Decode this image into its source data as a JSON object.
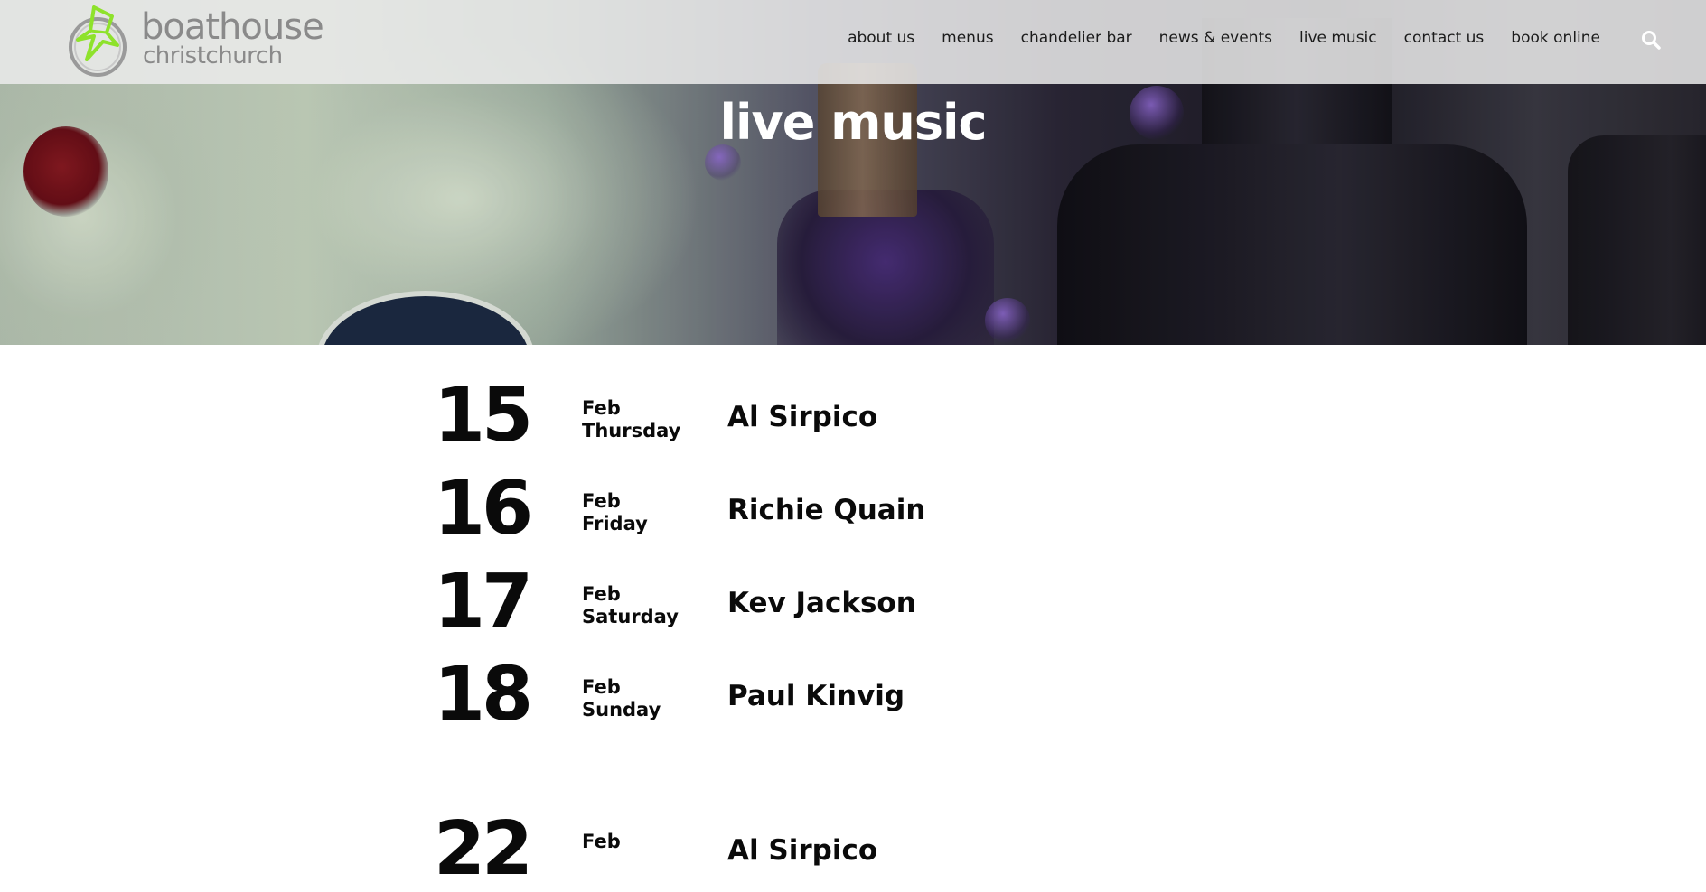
{
  "brand": {
    "name": "boathouse",
    "location": "christchurch"
  },
  "nav": {
    "items": [
      {
        "label": "about us"
      },
      {
        "label": "menus"
      },
      {
        "label": "chandelier bar"
      },
      {
        "label": "news & events"
      },
      {
        "label": "live music"
      },
      {
        "label": "contact us"
      },
      {
        "label": "book online"
      }
    ],
    "search_icon": "search-icon"
  },
  "hero": {
    "title": "live music"
  },
  "events": [
    {
      "day": "15",
      "month": "Feb",
      "weekday": "Thursday",
      "artist": "Al Sirpico"
    },
    {
      "day": "16",
      "month": "Feb",
      "weekday": "Friday",
      "artist": "Richie Quain"
    },
    {
      "day": "17",
      "month": "Feb",
      "weekday": "Saturday",
      "artist": "Kev Jackson"
    },
    {
      "day": "18",
      "month": "Feb",
      "weekday": "Sunday",
      "artist": "Paul Kinvig"
    },
    {
      "day": "22",
      "month": "Feb",
      "weekday": "",
      "artist": "Al Sirpico"
    }
  ],
  "colors": {
    "logo_accent": "#8ee22b",
    "logo_text": "#8a8a8a",
    "text": "#0a0a0a"
  }
}
